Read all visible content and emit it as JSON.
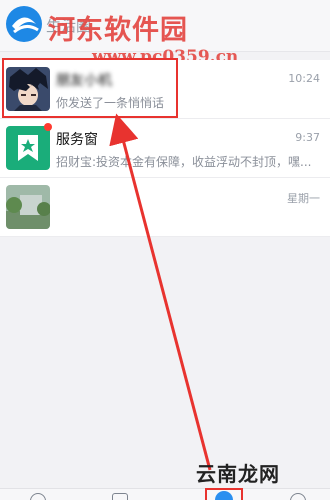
{
  "top_bar": {
    "label": "生活圈"
  },
  "watermark": {
    "title": "河东软件园",
    "url": "www.pc0359.cn",
    "footer": "云南龙网"
  },
  "conversations": [
    {
      "name": "朋友小机",
      "preview": "你发送了一条悄悄话",
      "time": "10:24",
      "highlighted": true
    },
    {
      "name": "服务窗",
      "preview": "招财宝:投资本金有保障，收益浮动不封顶，嘿...",
      "time": "9:37",
      "unread": true
    },
    {
      "name": "",
      "preview": "",
      "time": "星期一"
    }
  ],
  "bottom_nav": {
    "active_index": 2
  },
  "colors": {
    "accent_red": "#e8332f",
    "service_green": "#1aad7a",
    "nav_blue": "#2a8ff0"
  }
}
